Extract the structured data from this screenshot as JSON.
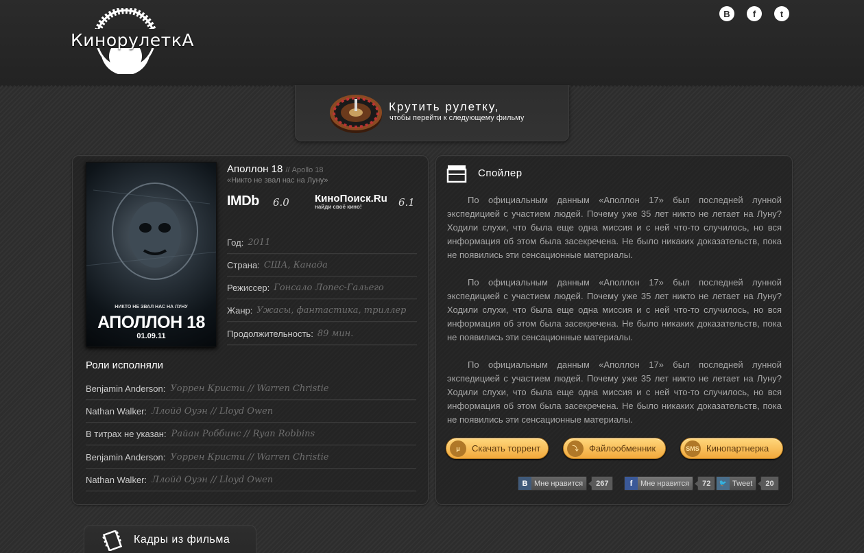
{
  "header": {
    "logo_text": "КинорулеткА",
    "social": [
      {
        "icon": "vk-icon",
        "glyph": "B"
      },
      {
        "icon": "facebook-icon",
        "glyph": "f"
      },
      {
        "icon": "twitter-icon",
        "glyph": "t"
      }
    ]
  },
  "roulette": {
    "title": "Крутить рулетку,",
    "subtitle": "чтобы перейти к следующему фильму"
  },
  "film": {
    "poster": {
      "tagline": "НИКТО НЕ ЗВАЛ НАС НА ЛУНУ",
      "title": "АПОЛЛОН 18",
      "date": "01.09.11"
    },
    "title": "Аполлон 18",
    "original_title": "// Apollo 18",
    "tagline": "«Никто не звал нас на Луну»",
    "ratings": {
      "imdb_label": "IMDb",
      "imdb_value": "6.0",
      "kp_label": "КиноПоиск.Ru",
      "kp_sub": "найди своё кино!",
      "kp_value": "6.1"
    },
    "info": [
      {
        "label": "Год:",
        "value": "2011"
      },
      {
        "label": "Страна:",
        "value": "США, Канада"
      },
      {
        "label": "Режиссер:",
        "value": "Гонсало Лопес-Гальего"
      },
      {
        "label": "Жанр:",
        "value": "Ужасы, фантастика, триллер"
      },
      {
        "label": "Продолжительность:",
        "value": "89 мин."
      }
    ],
    "cast_heading": "Роли исполняли",
    "cast": [
      {
        "role": "Benjamin Anderson:",
        "actor": "Уоррен Кристи // Warren Christie"
      },
      {
        "role": "Nathan Walker:",
        "actor": "Ллойд Оуэн // Lloyd Owen"
      },
      {
        "role": "В титрах не указан:",
        "actor": "Райан Роббинс // Ryan Robbins"
      },
      {
        "role": "Benjamin Anderson:",
        "actor": "Уоррен Кристи // Warren Christie"
      },
      {
        "role": "Nathan Walker:",
        "actor": "Ллойд Оуэн // Lloyd Owen"
      }
    ]
  },
  "spoiler": {
    "title": "Спойлер",
    "paragraphs": [
      "По официальным данным «Аполлон 17» был последней лунной экспедицией с участием людей. Почему уже 35 лет никто не летает на Луну? Ходили слухи, что была еще одна миссия и с ней что-то случилось, но вся информация об этом была засекречена. Не было никаких доказательств, пока не появились эти сенсационные материалы.",
      "По официальным данным «Аполлон 17» был последней лунной экспедицией с участием людей. Почему уже 35 лет никто не летает на Луну? Ходили слухи, что была еще одна миссия и с ней что-то случилось, но вся информация об этом была засекречена. Не было никаких доказательств, пока не появились эти сенсационные материалы.",
      "По официальным данным «Аполлон 17» был последней лунной экспедицией с участием людей. Почему уже 35 лет никто не летает на Луну? Ходили слухи, что была еще одна миссия и с ней что-то случилось, но вся информация об этом была засекречена. Не было никаких доказательств, пока не появились эти сенсационные материалы."
    ],
    "buttons": [
      {
        "label": "Скачать торрент",
        "icon": "torrent-icon",
        "glyph": "μ"
      },
      {
        "label": "Файлообменник",
        "icon": "file-share-icon",
        "glyph": "⤵"
      },
      {
        "label": "Кинопартнерка",
        "icon": "sms-icon",
        "glyph": "SMS"
      }
    ],
    "likes": [
      {
        "icon": "vk-like-icon",
        "glyph": "B",
        "label": "Мне нравится",
        "count": "267"
      },
      {
        "icon": "facebook-like-icon",
        "glyph": "f",
        "label": "Мне нравится",
        "count": "72"
      },
      {
        "icon": "twitter-tweet-icon",
        "glyph": "🐦",
        "label": "Tweet",
        "count": "20"
      }
    ]
  },
  "frames": {
    "title": "Кадры из фильма"
  },
  "colors": {
    "background": "#2e2e2e",
    "accent_button": "#f2a93c",
    "muted_value": "#6f6f6f"
  }
}
